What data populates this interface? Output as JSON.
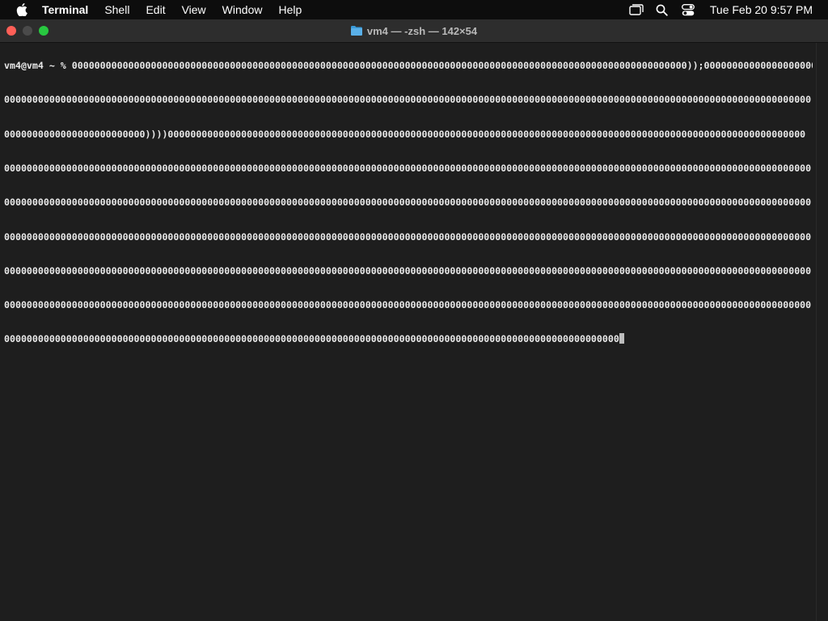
{
  "menubar": {
    "app_name": "Terminal",
    "items": [
      "Shell",
      "Edit",
      "View",
      "Window",
      "Help"
    ],
    "clock": "Tue Feb 20  9:57 PM",
    "icons": [
      "apple-logo",
      "screen-mirroring",
      "spotlight-search",
      "control-center"
    ]
  },
  "window": {
    "title": "vm4 — -zsh — 142×54",
    "folder_icon_color": "#3a9ad9"
  },
  "terminal": {
    "lines": [
      "vm4@vm4 ~ % 0000000000000000000000000000000000000000000000000000000000000000000000000000000000000000000000000000000000000));00000000000000000000000000000",
      "00000000000000000000000000000000000000000000000000000000000000000000000000000000000000000000000000000000000000000000000000000000000000000000000",
      "0000000000000000000000000))))00000000000000000000000000000000000000000000000000000000000000000000000000000000000000000000000000000000000000000",
      "00000000000000000000000000000000000000000000000000000000000000000000000000000000000000000000000000000000000000000000000000000000000000000000000",
      "00000000000000000000000000000000000000000000000000000000000000000000000000000000000000000000000000000000000000000000000000000000000000000000000",
      "00000000000000000000000000000000000000000000000000000000000000000000000000000000000000000000000000000000000000000000000000000000000000000000000",
      "00000000000000000000000000000000000000000000000000000000000000000000000000000000000000000000000000000000000000000000000000000000000000000000000",
      "00000000000000000000000000000000000000000000000000000000000000000000000000000000000000000000000000000000000000000000000000000000000000000000000"
    ],
    "last_line": "0000000000000000000000000000000000000000000000000000000000000000000000000000000000000000000000000000000000000"
  },
  "colors": {
    "background": "#1e1e1e",
    "titlebar": "#2d2d2d",
    "text": "#e8e8e8",
    "close": "#ff5f57",
    "maximize": "#28c840"
  }
}
